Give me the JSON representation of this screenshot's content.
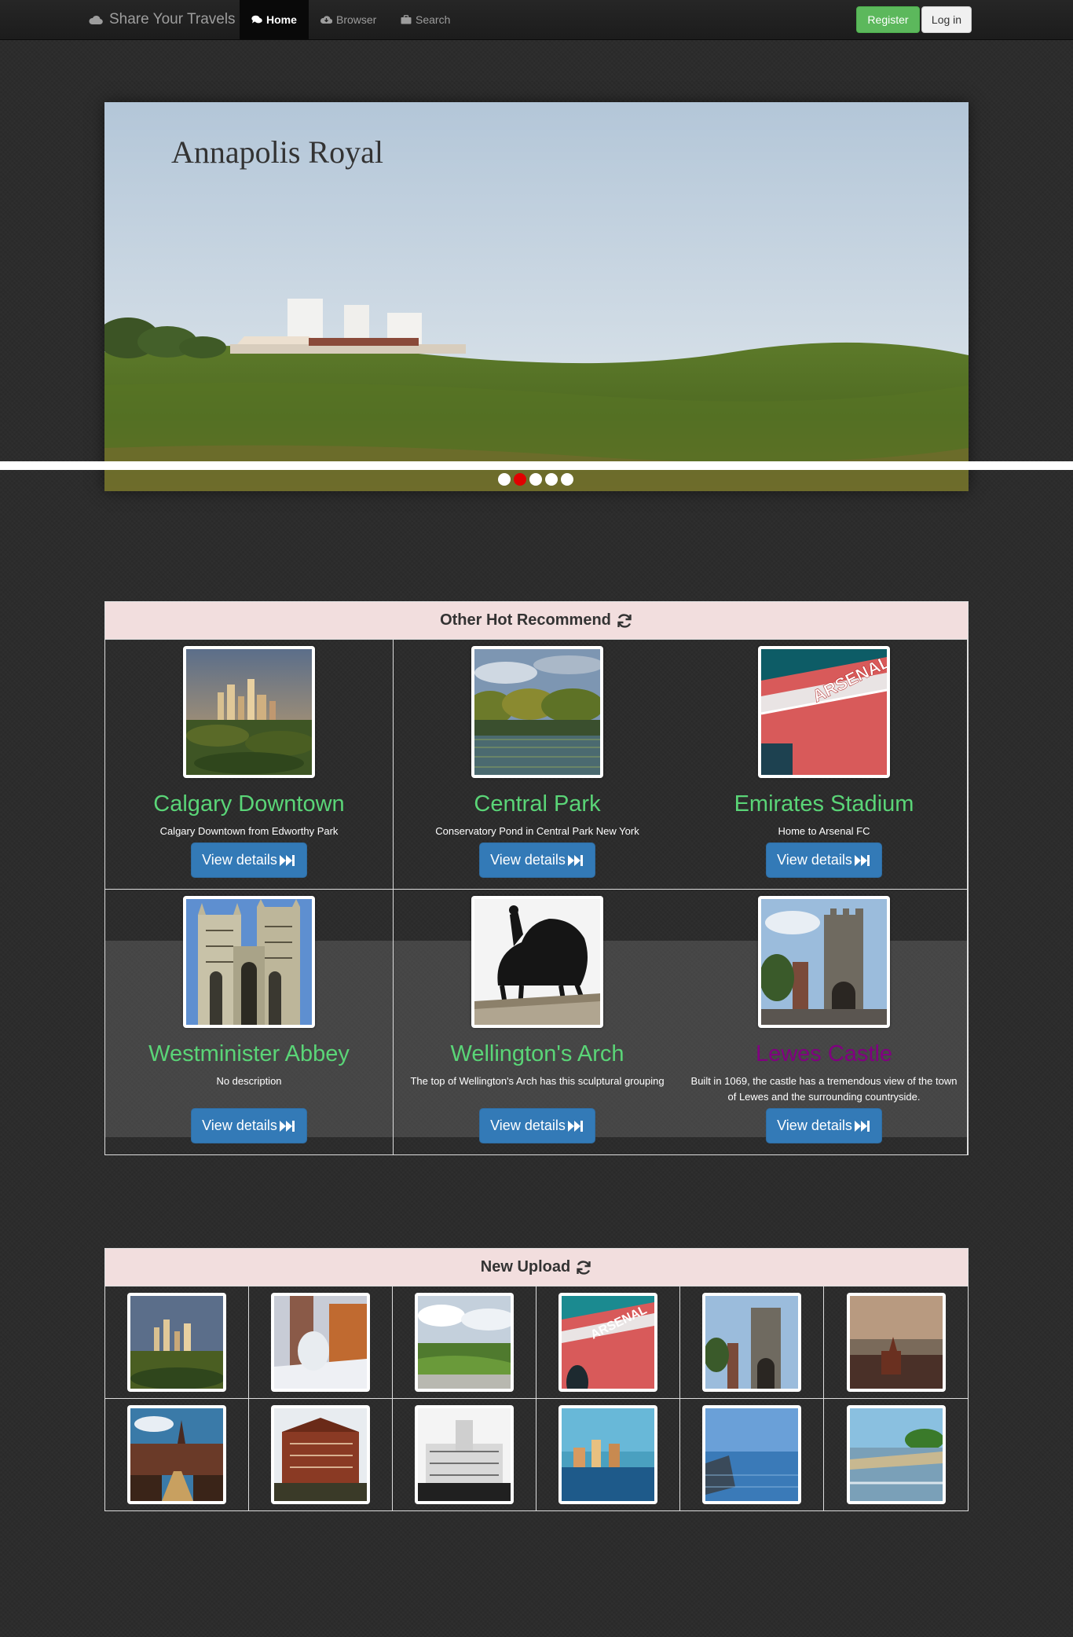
{
  "nav": {
    "brand": "Share Your Travels",
    "items": [
      {
        "label": "Home",
        "icon": "comments-icon",
        "active": true
      },
      {
        "label": "Browser",
        "icon": "cloud-download-icon",
        "active": false
      },
      {
        "label": "Search",
        "icon": "briefcase-icon",
        "active": false
      }
    ],
    "register": "Register",
    "login": "Log in"
  },
  "carousel": {
    "title": "Annapolis Royal",
    "slide_count": 5,
    "active_index": 1
  },
  "recommend": {
    "heading": "Other Hot Recommend",
    "view_label": "View details",
    "items": [
      {
        "name": "Calgary Downtown",
        "desc": "Calgary Downtown from Edworthy Park",
        "image": "city-skyline"
      },
      {
        "name": "Central Park",
        "desc": "Conservatory Pond in Central Park New York",
        "image": "park-pond"
      },
      {
        "name": "Emirates Stadium",
        "desc": "Home to Arsenal FC",
        "image": "arsenal-sign"
      },
      {
        "name": "Westminister Abbey",
        "desc": "No description",
        "image": "gothic-abbey"
      },
      {
        "name": "Wellington's Arch",
        "desc": "The top of Wellington's Arch has this sculptural grouping",
        "image": "horse-statue"
      },
      {
        "name": "Lewes Castle",
        "desc": "Built in 1069, the castle has a tremendous view of the town of Lewes and the surrounding countryside.",
        "image": "stone-castle",
        "visited": true
      }
    ]
  },
  "uploads": {
    "heading": "New Upload",
    "images": [
      "city-skyline",
      "snowy-street",
      "green-fields",
      "arsenal-sign",
      "stone-castle",
      "harbor-town",
      "canal-church",
      "red-building",
      "white-palace",
      "sea-city",
      "boat-sea",
      "palm-beach"
    ]
  },
  "colors": {
    "accent_link": "#5ad577",
    "visited_link": "#800080",
    "primary_button": "#337ab7",
    "success_button": "#5cb85c",
    "panel_heading": "#f2dede",
    "active_dot": "#e00000"
  }
}
